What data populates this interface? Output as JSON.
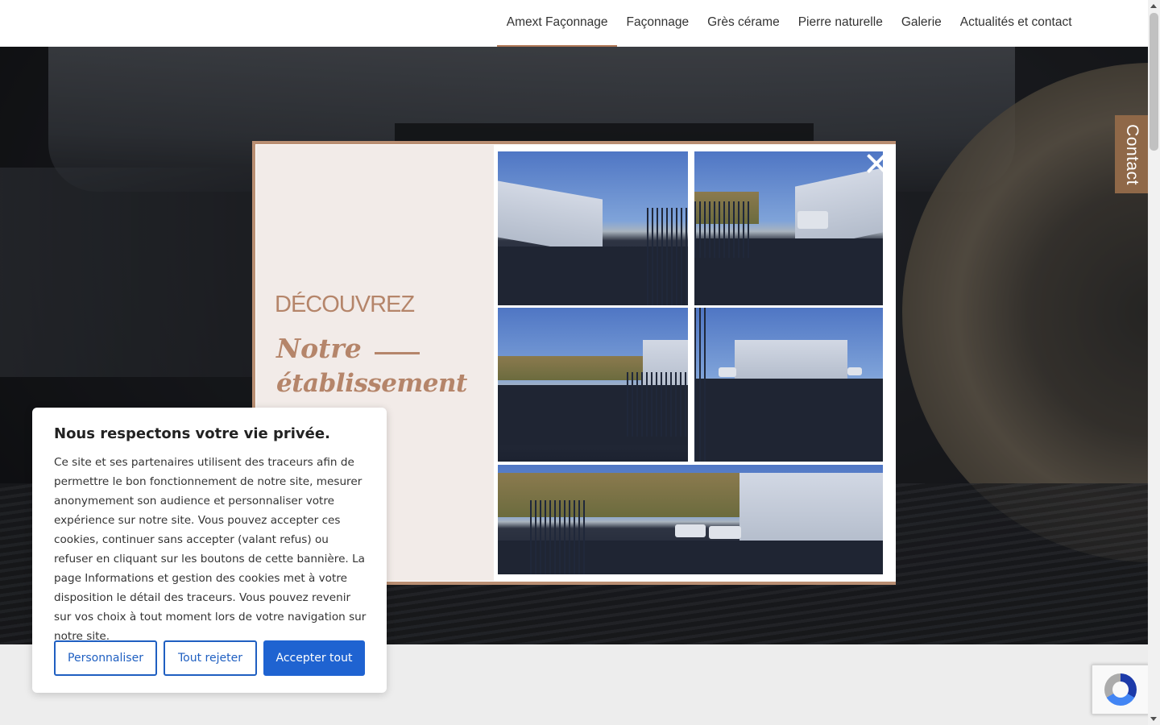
{
  "nav": {
    "items": [
      {
        "label": "Amext Façonnage",
        "active": true
      },
      {
        "label": "Façonnage"
      },
      {
        "label": "Grès cérame"
      },
      {
        "label": "Pierre naturelle"
      },
      {
        "label": "Galerie"
      },
      {
        "label": "Actualités et contact"
      }
    ],
    "accent_color": "#b27a58"
  },
  "contact_tab": {
    "label": "Contact",
    "color": "#8f6848"
  },
  "popup": {
    "heading": "DÉCOUVREZ",
    "line1": "Notre",
    "line2": "établissement",
    "text_color": "#b5856a",
    "border_color": "#b98e72",
    "close_icon": "close-icon"
  },
  "cookie": {
    "title": "Nous respectons votre vie privée.",
    "text": "Ce site et ses partenaires utilisent des traceurs afin de permettre le bon fonctionnement de notre site, mesurer anonymement son audience et personnaliser votre expérience sur notre site. Vous pouvez accepter ces cookies, continuer sans accepter (valant refus) ou refuser en cliquant sur les boutons de cette bannière. La page Informations et gestion des cookies met à votre disposition le détail des traceurs. Vous pouvez revenir sur vos choix à tout moment lors de votre navigation sur notre site.",
    "buttons": {
      "customize": "Personnaliser",
      "reject": "Tout rejeter",
      "accept": "Accepter tout"
    },
    "accent_color": "#1f63d1"
  },
  "recaptcha": {
    "icon": "recaptcha-icon"
  }
}
